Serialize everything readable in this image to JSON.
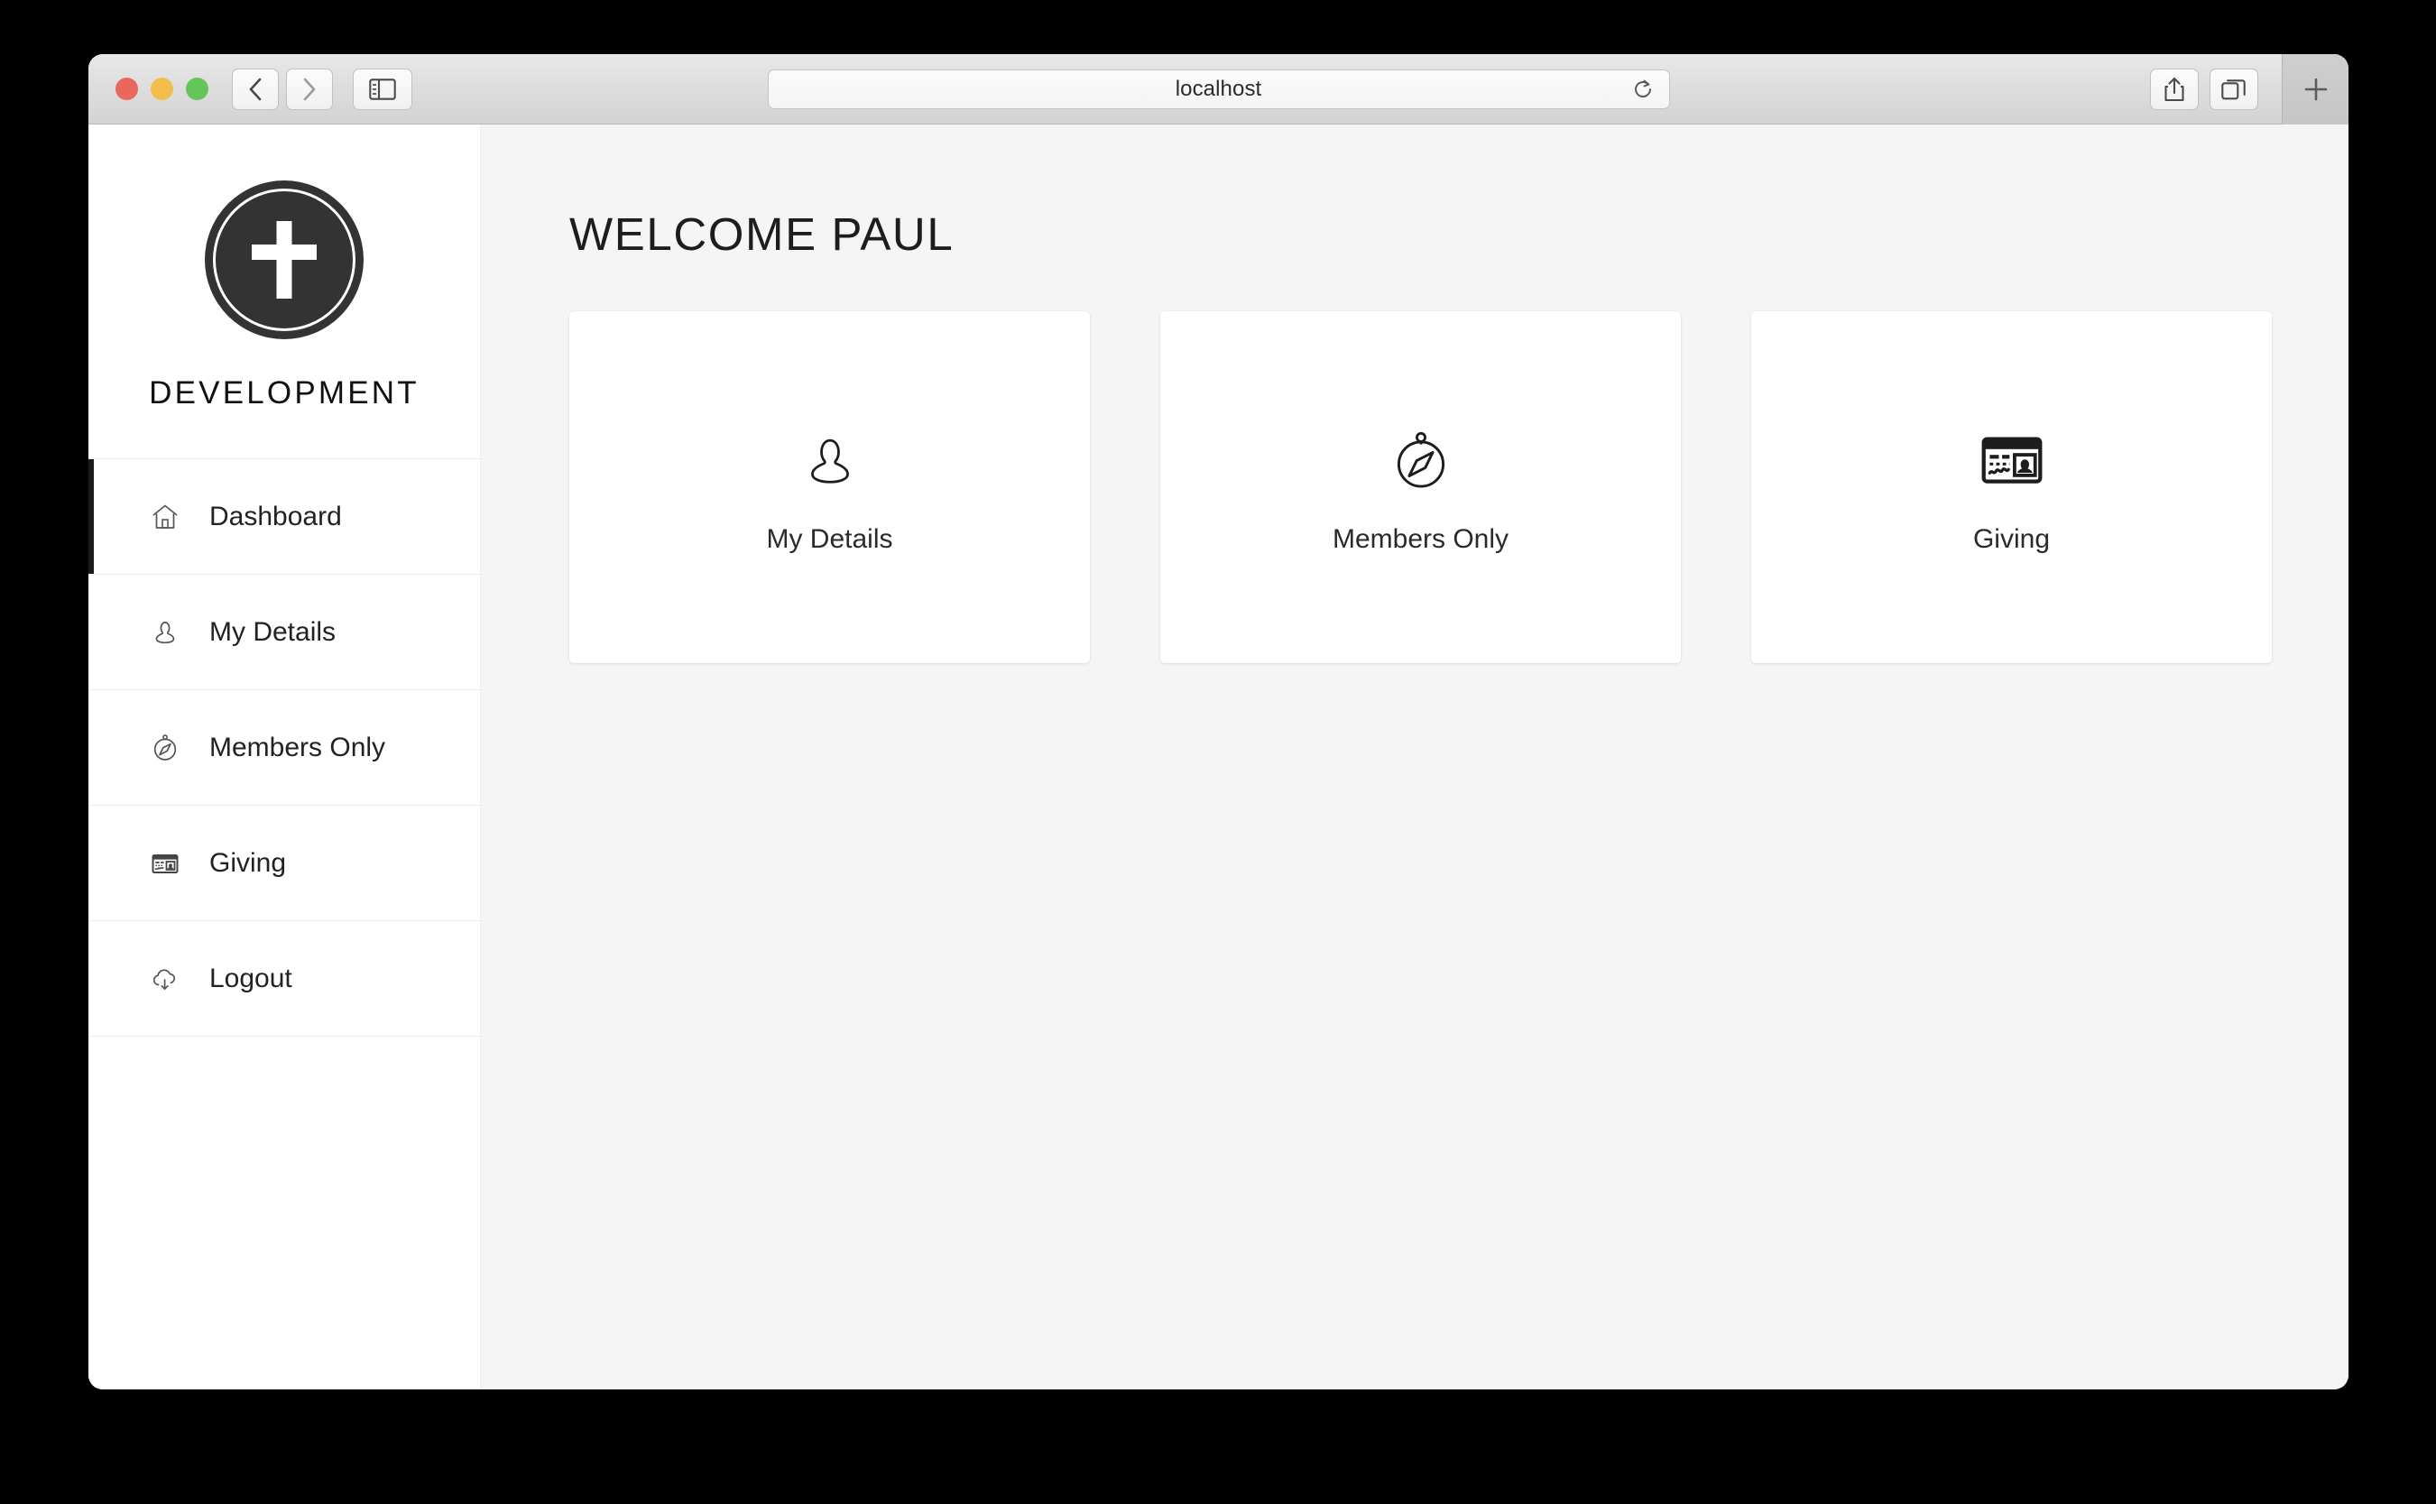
{
  "browser": {
    "url": "localhost",
    "traffic_lights": [
      {
        "name": "close",
        "color": "#e8685e"
      },
      {
        "name": "minimize",
        "color": "#f2bd4c"
      },
      {
        "name": "maximize",
        "color": "#64c558"
      }
    ],
    "buttons": {
      "back": "back-icon",
      "forward": "forward-icon",
      "sidebar": "sidebar-toggle-icon",
      "reload": "reload-icon",
      "share": "share-icon",
      "tab_overview": "tab-overview-icon",
      "new_tab": "+"
    }
  },
  "sidebar": {
    "brand_name": "DEVELOPMENT",
    "logo_icon": "cross-icon",
    "items": [
      {
        "label": "Dashboard",
        "icon": "home-icon",
        "active": true
      },
      {
        "label": "My Details",
        "icon": "person-icon",
        "active": false
      },
      {
        "label": "Members Only",
        "icon": "compass-icon",
        "active": false
      },
      {
        "label": "Giving",
        "icon": "card-icon",
        "active": false
      },
      {
        "label": "Logout",
        "icon": "cloud-download-icon",
        "active": false
      }
    ]
  },
  "main": {
    "title": "WELCOME PAUL",
    "cards": [
      {
        "label": "My Details",
        "icon": "person-icon"
      },
      {
        "label": "Members Only",
        "icon": "compass-icon"
      },
      {
        "label": "Giving",
        "icon": "card-icon"
      }
    ]
  },
  "colors": {
    "accent": "#1a1a1a",
    "logo_bg": "#333333",
    "page_bg": "#f5f5f5",
    "sidebar_bg": "#ffffff"
  }
}
